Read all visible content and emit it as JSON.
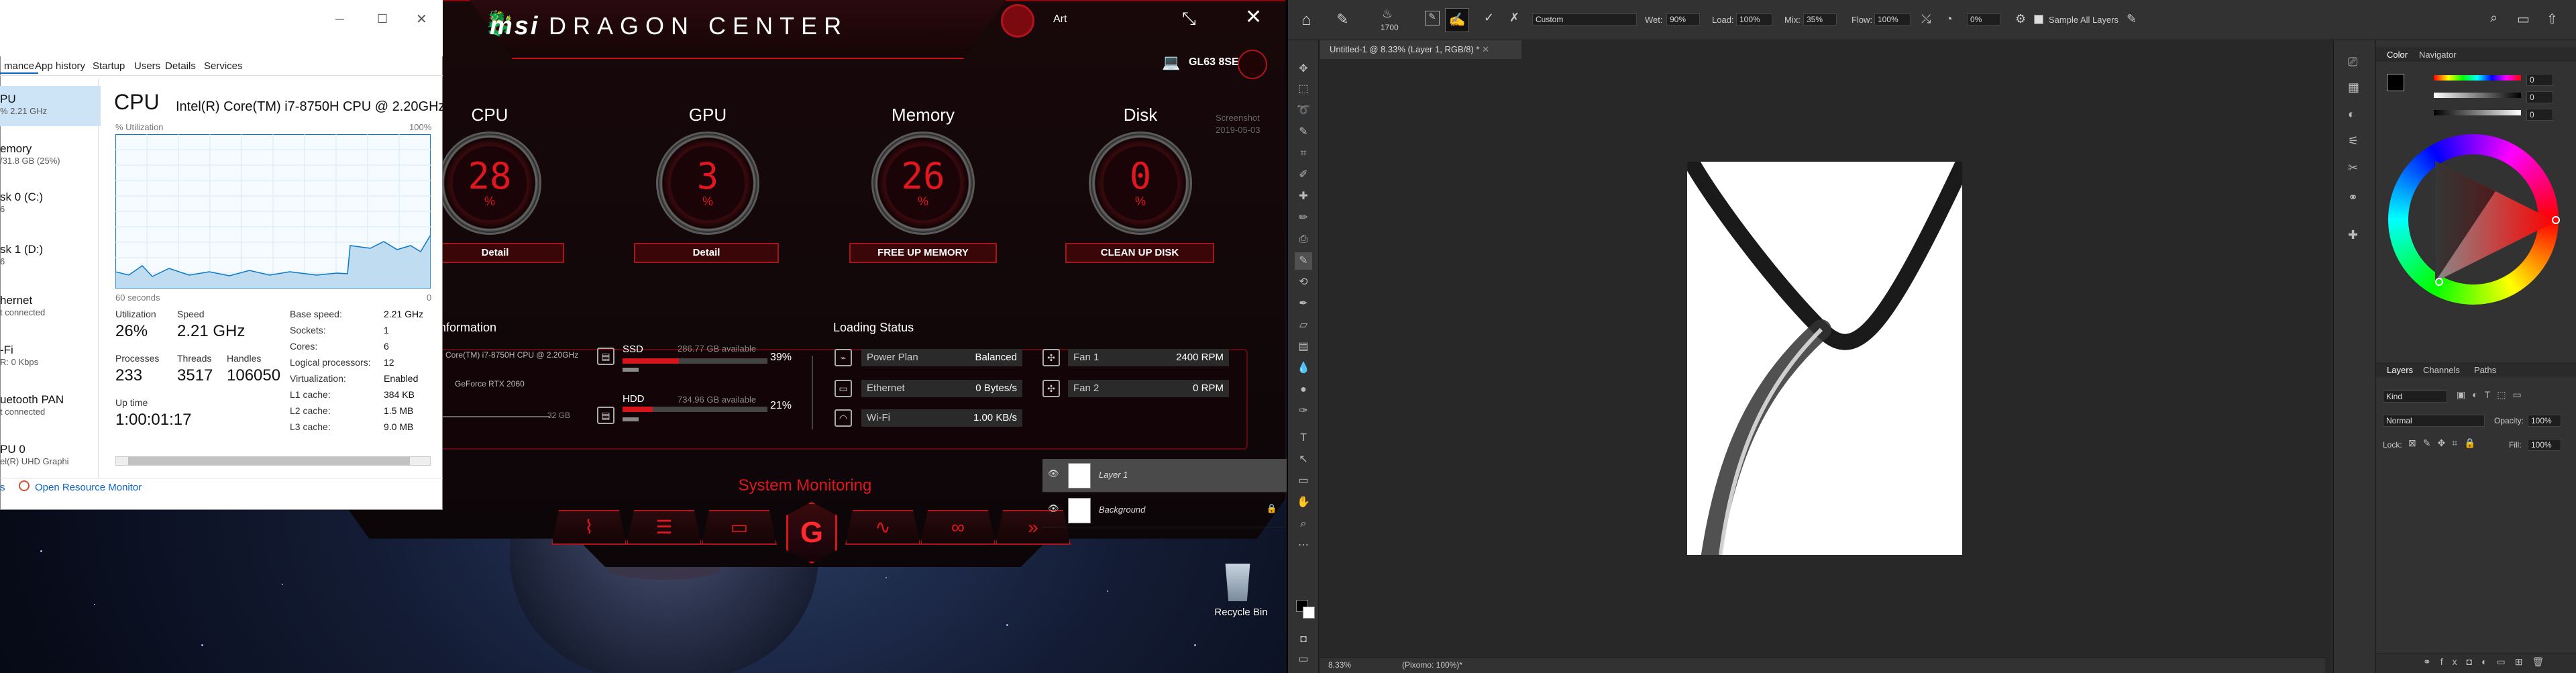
{
  "taskmanager": {
    "tabs": [
      "mance",
      "App history",
      "Startup",
      "Users",
      "Details",
      "Services"
    ],
    "sidebar": [
      {
        "title": "PU",
        "sub": "% 2.21 GHz"
      },
      {
        "title": "emory",
        "sub": "/31.8 GB (25%)"
      },
      {
        "title": "sk 0 (C:)",
        "sub": "6"
      },
      {
        "title": "sk 1 (D:)",
        "sub": "6"
      },
      {
        "title": "hernet",
        "sub": "t connected"
      },
      {
        "title": "-Fi",
        "sub": "R: 0 Kbps"
      },
      {
        "title": "uetooth PAN",
        "sub": "t connected"
      },
      {
        "title": "PU 0",
        "sub": "el(R) UHD Graphi"
      }
    ],
    "heading": "CPU",
    "cpu_model": "Intel(R) Core(TM) i7-8750H CPU @ 2.20GHz",
    "util_label": "% Utilization",
    "util_max": "100%",
    "time_label": "60 seconds",
    "time_zero": "0",
    "utilization_label": "Utilization",
    "utilization": "26%",
    "speed_label": "Speed",
    "speed": "2.21 GHz",
    "processes_label": "Processes",
    "processes": "233",
    "threads_label": "Threads",
    "threads": "3517",
    "handles_label": "Handles",
    "handles": "106050",
    "uptime_label": "Up time",
    "uptime": "1:00:01:17",
    "specs": [
      {
        "k": "Base speed:",
        "v": "2.21 GHz"
      },
      {
        "k": "Sockets:",
        "v": "1"
      },
      {
        "k": "Cores:",
        "v": "6"
      },
      {
        "k": "Logical processors:",
        "v": "12"
      },
      {
        "k": "Virtualization:",
        "v": "Enabled"
      },
      {
        "k": "L1 cache:",
        "v": "384 KB"
      },
      {
        "k": "L2 cache:",
        "v": "1.5 MB"
      },
      {
        "k": "L3 cache:",
        "v": "9.0 MB"
      }
    ],
    "footer_left": "s",
    "footer_link": "Open Resource Monitor"
  },
  "msi": {
    "brand": "msi",
    "title": "DRAGON CENTER",
    "profile": "Art",
    "model": "GL63 8SE",
    "desktop_hint": [
      "Screenshot",
      "2019-05-03"
    ],
    "gauges": [
      {
        "label": "CPU",
        "value": "28",
        "unit": "%",
        "button": "Detail"
      },
      {
        "label": "GPU",
        "value": "3",
        "unit": "%",
        "button": "Detail"
      },
      {
        "label": "Memory",
        "value": "26",
        "unit": "%",
        "button": "FREE UP MEMORY"
      },
      {
        "label": "Disk",
        "value": "0",
        "unit": "%",
        "button": "CLEAN UP DISK"
      }
    ],
    "info_title": "nformation",
    "info_cpu": "Core(TM) i7-8750H CPU @ 2.20GHz",
    "info_gpu": "GeForce RTX 2060",
    "info_mem": "32 GB",
    "ssd_label": "SSD",
    "ssd_avail": "286.77 GB available",
    "ssd_pct": "39%",
    "ssd_fill": 0.39,
    "hdd_label": "HDD",
    "hdd_avail": "734.96 GB available",
    "hdd_pct": "21%",
    "hdd_fill": 0.21,
    "loading_title": "Loading Status",
    "status": [
      {
        "k": "Power Plan",
        "v": "Balanced"
      },
      {
        "k": "Ethernet",
        "v": "0 Bytes/s"
      },
      {
        "k": "Wi-Fi",
        "v": "1.00 KB/s"
      }
    ],
    "fans": [
      {
        "k": "Fan 1",
        "v": "2400 RPM"
      },
      {
        "k": "Fan 2",
        "v": "0 RPM"
      }
    ],
    "system_monitoring": "System Monitoring"
  },
  "desktop": {
    "recycle_bin": "Recycle Bin"
  },
  "photoshop": {
    "brush_size": "1700",
    "mode": "Custom",
    "wet_label": "Wet:",
    "wet": "90%",
    "load_label": "Load:",
    "load": "100%",
    "mix_label": "Mix:",
    "mix": "35%",
    "flow_label": "Flow:",
    "flow": "100%",
    "angle": "0%",
    "sample_all": "Sample All Layers",
    "doc_tab": "Untitled-1 @ 8.33% (Layer 1, RGB/8) *",
    "zoom": "8.33%",
    "status": "(Pixomo: 100%)*",
    "color_tab": "Color",
    "navigator_tab": "Navigator",
    "layers_tab": "Layers",
    "channels_tab": "Channels",
    "paths_tab": "Paths",
    "kind": "Kind",
    "blend": "Normal",
    "opacity_label": "Opacity:",
    "opacity": "100%",
    "lock_label": "Lock:",
    "fill_label": "Fill:",
    "fill": "100%",
    "layers": [
      "Layer 1",
      "Background"
    ],
    "color_values": [
      "0",
      "0",
      "0"
    ]
  }
}
